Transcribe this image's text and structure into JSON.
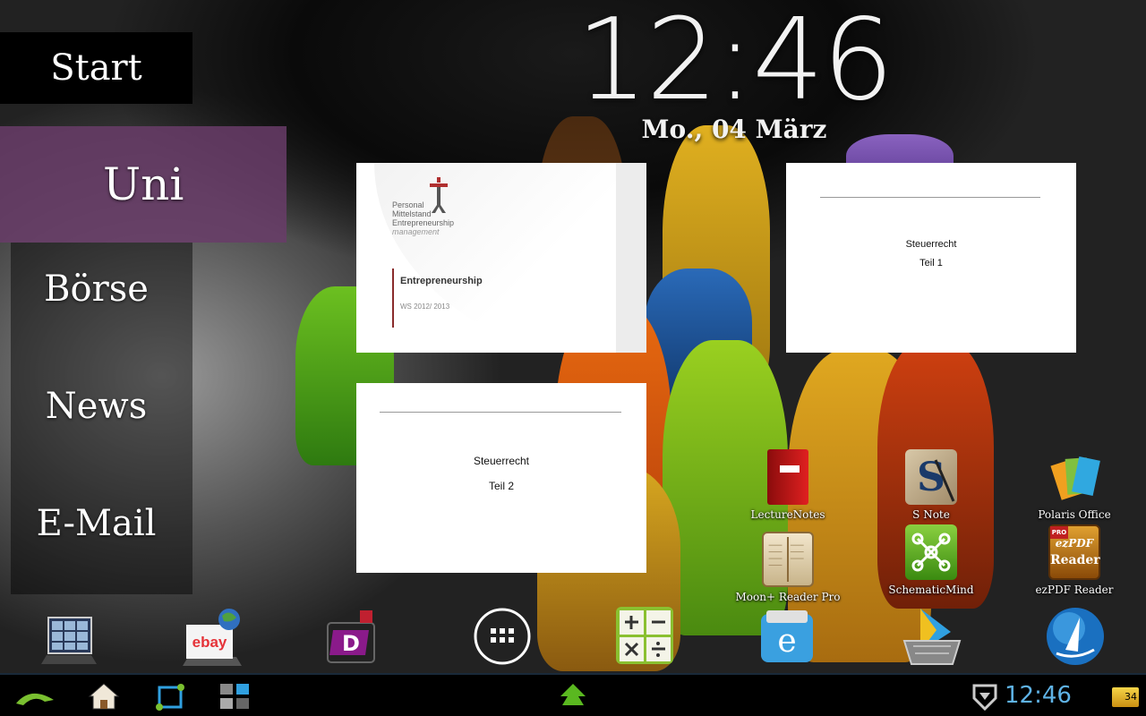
{
  "clock": {
    "time": "12:46",
    "date": "Mo., 04 März"
  },
  "menu": {
    "items": [
      {
        "label": "Start"
      },
      {
        "label": "Uni"
      },
      {
        "label": "Börse"
      },
      {
        "label": "News"
      },
      {
        "label": "E-Mail"
      }
    ],
    "selected": "Uni",
    "accent": "#693c69"
  },
  "documents": [
    {
      "logo_lines": [
        "Personal",
        "Mittelstand",
        "Entrepreneurship",
        "management"
      ],
      "title": "Entrepreneurship",
      "subtitle": "WS 2012/ 2013"
    },
    {
      "line1": "Steuerrecht",
      "line2": "Teil 1"
    },
    {
      "line1": "Steuerrecht",
      "line2": "Teil 2"
    }
  ],
  "apps": [
    {
      "label": "LectureNotes",
      "icon": "red-notebook-icon"
    },
    {
      "label": "S Note",
      "icon": "s-note-icon"
    },
    {
      "label": "Polaris Office",
      "icon": "polaris-office-icon"
    },
    {
      "label": "Moon+ Reader Pro",
      "icon": "open-book-icon"
    },
    {
      "label": "SchematicMind",
      "icon": "mind-map-icon"
    },
    {
      "label": "ezPDF Reader",
      "icon": "ezpdf-reader-icon",
      "badge": "PRO",
      "brand": "ezPDF",
      "word": "Reader"
    }
  ],
  "dock": {
    "ebay_label": "ebay",
    "icons": [
      "gallery-icon",
      "ebay-icon",
      "d-app-icon",
      "app-drawer-icon",
      "calculator-icon",
      "file-manager-icon",
      "play-store-icon",
      "browser-globe-icon"
    ]
  },
  "status": {
    "time": "12:46",
    "battery_level": "34",
    "time_color": "#5fb3e6"
  }
}
